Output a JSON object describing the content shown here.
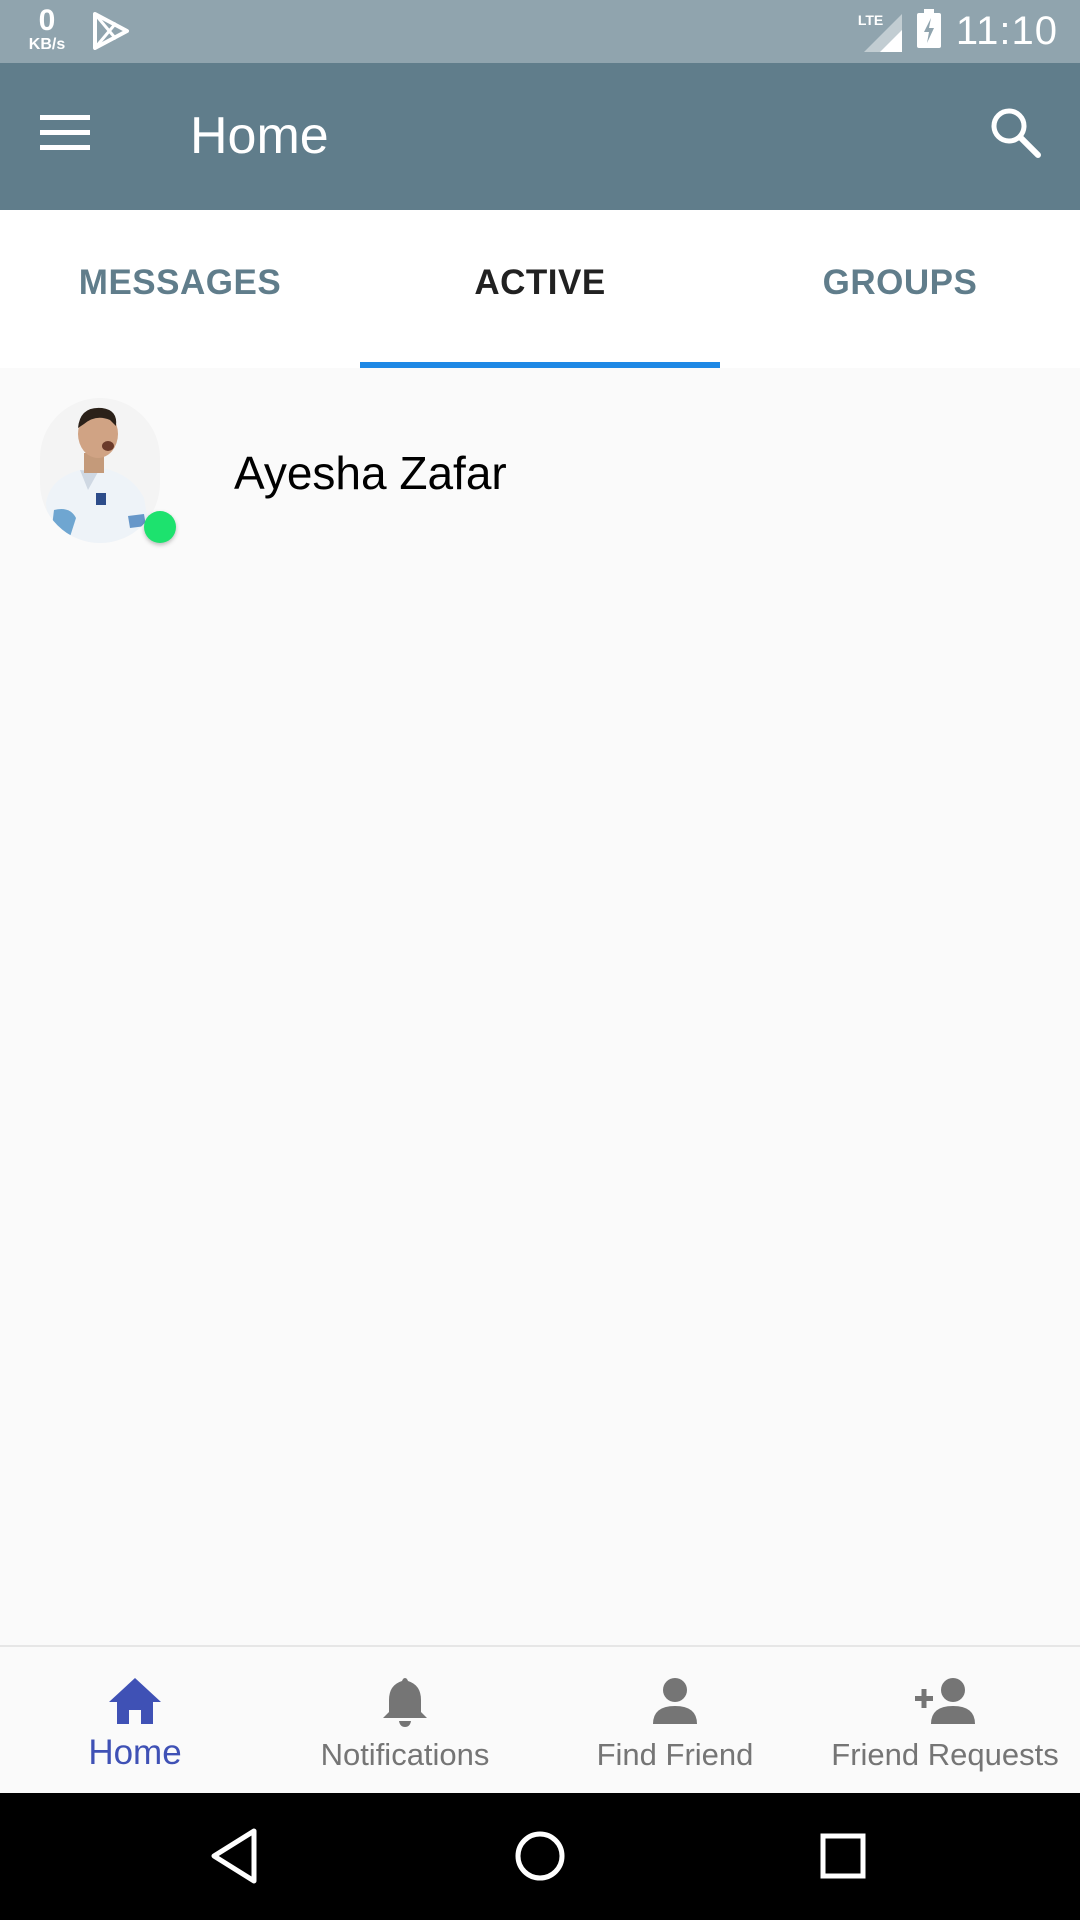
{
  "status_bar": {
    "speed_value": "0",
    "speed_unit": "KB/s",
    "network": "LTE",
    "time": "11:10"
  },
  "app_bar": {
    "title": "Home"
  },
  "tabs": [
    {
      "label": "MESSAGES",
      "active": false
    },
    {
      "label": "ACTIVE",
      "active": true
    },
    {
      "label": "GROUPS",
      "active": false
    }
  ],
  "active_users": [
    {
      "name": "Ayesha Zafar",
      "online": true
    }
  ],
  "bottom_nav": [
    {
      "label": "Home",
      "icon": "home-icon",
      "active": true
    },
    {
      "label": "Notifications",
      "icon": "bell-icon",
      "active": false
    },
    {
      "label": "Find Friend",
      "icon": "person-icon",
      "active": false
    },
    {
      "label": "Friend Requests",
      "icon": "person-add-icon",
      "active": false
    }
  ],
  "colors": {
    "status_bar": "#90a4ae",
    "app_bar": "#607d8b",
    "tab_indicator": "#1e88e5",
    "online": "#1de26e",
    "nav_active": "#3f51b5"
  }
}
